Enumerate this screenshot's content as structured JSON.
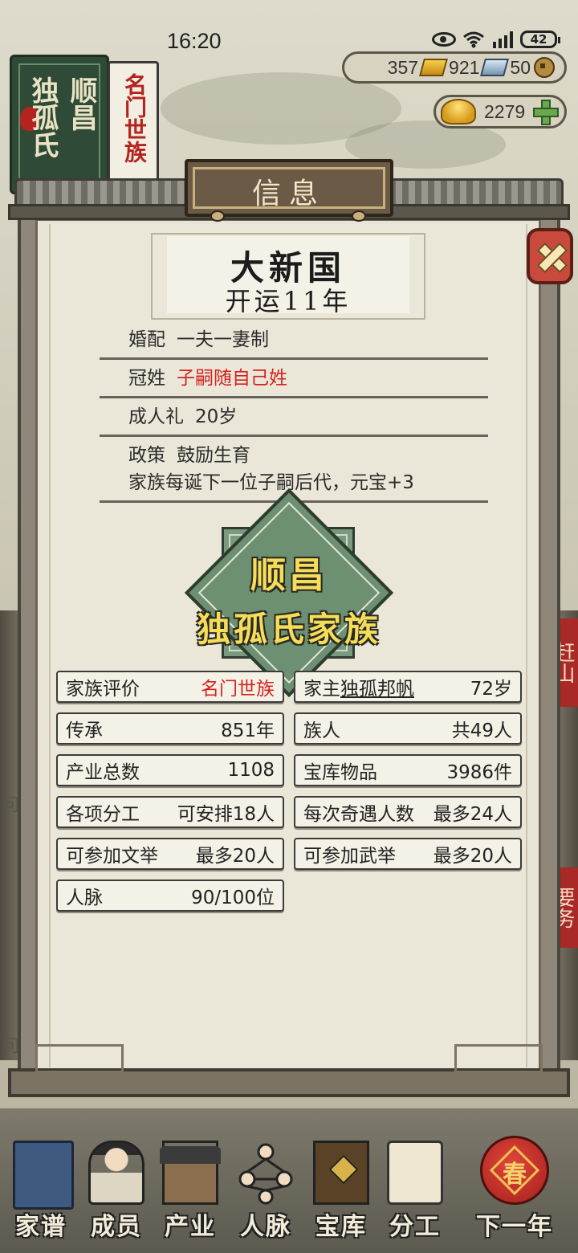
{
  "status": {
    "time": "16:20",
    "battery": "42"
  },
  "family_book": {
    "left_line1": "顺昌",
    "left_line2": "独孤氏",
    "right_label": "名门世族"
  },
  "currency": {
    "gold": "357",
    "silver": "921",
    "coins": "50",
    "yuanbao": "2279"
  },
  "dialog": {
    "title": "信息",
    "country": {
      "name": "大新国",
      "era": "开运11年"
    },
    "rows": [
      {
        "label": "婚配",
        "value": "一夫一妻制"
      },
      {
        "label": "冠姓",
        "value": "子嗣随自己姓"
      },
      {
        "label": "成人礼",
        "value": "20岁"
      },
      {
        "label": "政策",
        "value": "鼓励生育",
        "note": "家族每诞下一位子嗣后代，元宝+3"
      }
    ],
    "emblem": {
      "place": "顺昌",
      "clan": "独孤氏家族"
    },
    "stats": {
      "rating": {
        "label": "家族评价",
        "value": "名门世族"
      },
      "head": {
        "label": "家主",
        "name": "独孤邦帆",
        "age": "72岁"
      },
      "legacy": {
        "label": "传承",
        "value": "851年"
      },
      "members": {
        "label": "族人",
        "value": "共49人"
      },
      "industry": {
        "label": "产业总数",
        "value": "1108"
      },
      "treasury": {
        "label": "宝库物品",
        "value": "3986件"
      },
      "work": {
        "label": "各项分工",
        "value": "可安排18人"
      },
      "encounter": {
        "label": "每次奇遇人数",
        "value": "最多24人"
      },
      "civil_exam": {
        "label": "可参加文举",
        "value": "最多20人"
      },
      "military_exam": {
        "label": "可参加武举",
        "value": "最多20人"
      },
      "network": {
        "label": "人脉",
        "value": "90/100位"
      }
    }
  },
  "side_banners": {
    "right_top": "赶山",
    "right_mid": "要务",
    "left_a": "可",
    "left_b": "可"
  },
  "nav": {
    "genealogy": "家谱",
    "members": "成员",
    "industry": "产业",
    "network": "人脉",
    "treasury": "宝库",
    "work": "分工",
    "next_year": "下一年",
    "spring_char": "春"
  },
  "colors": {
    "accent_red": "#d3231f",
    "emblem_green": "#6d8f72",
    "emblem_text": "#f5dd5a"
  }
}
